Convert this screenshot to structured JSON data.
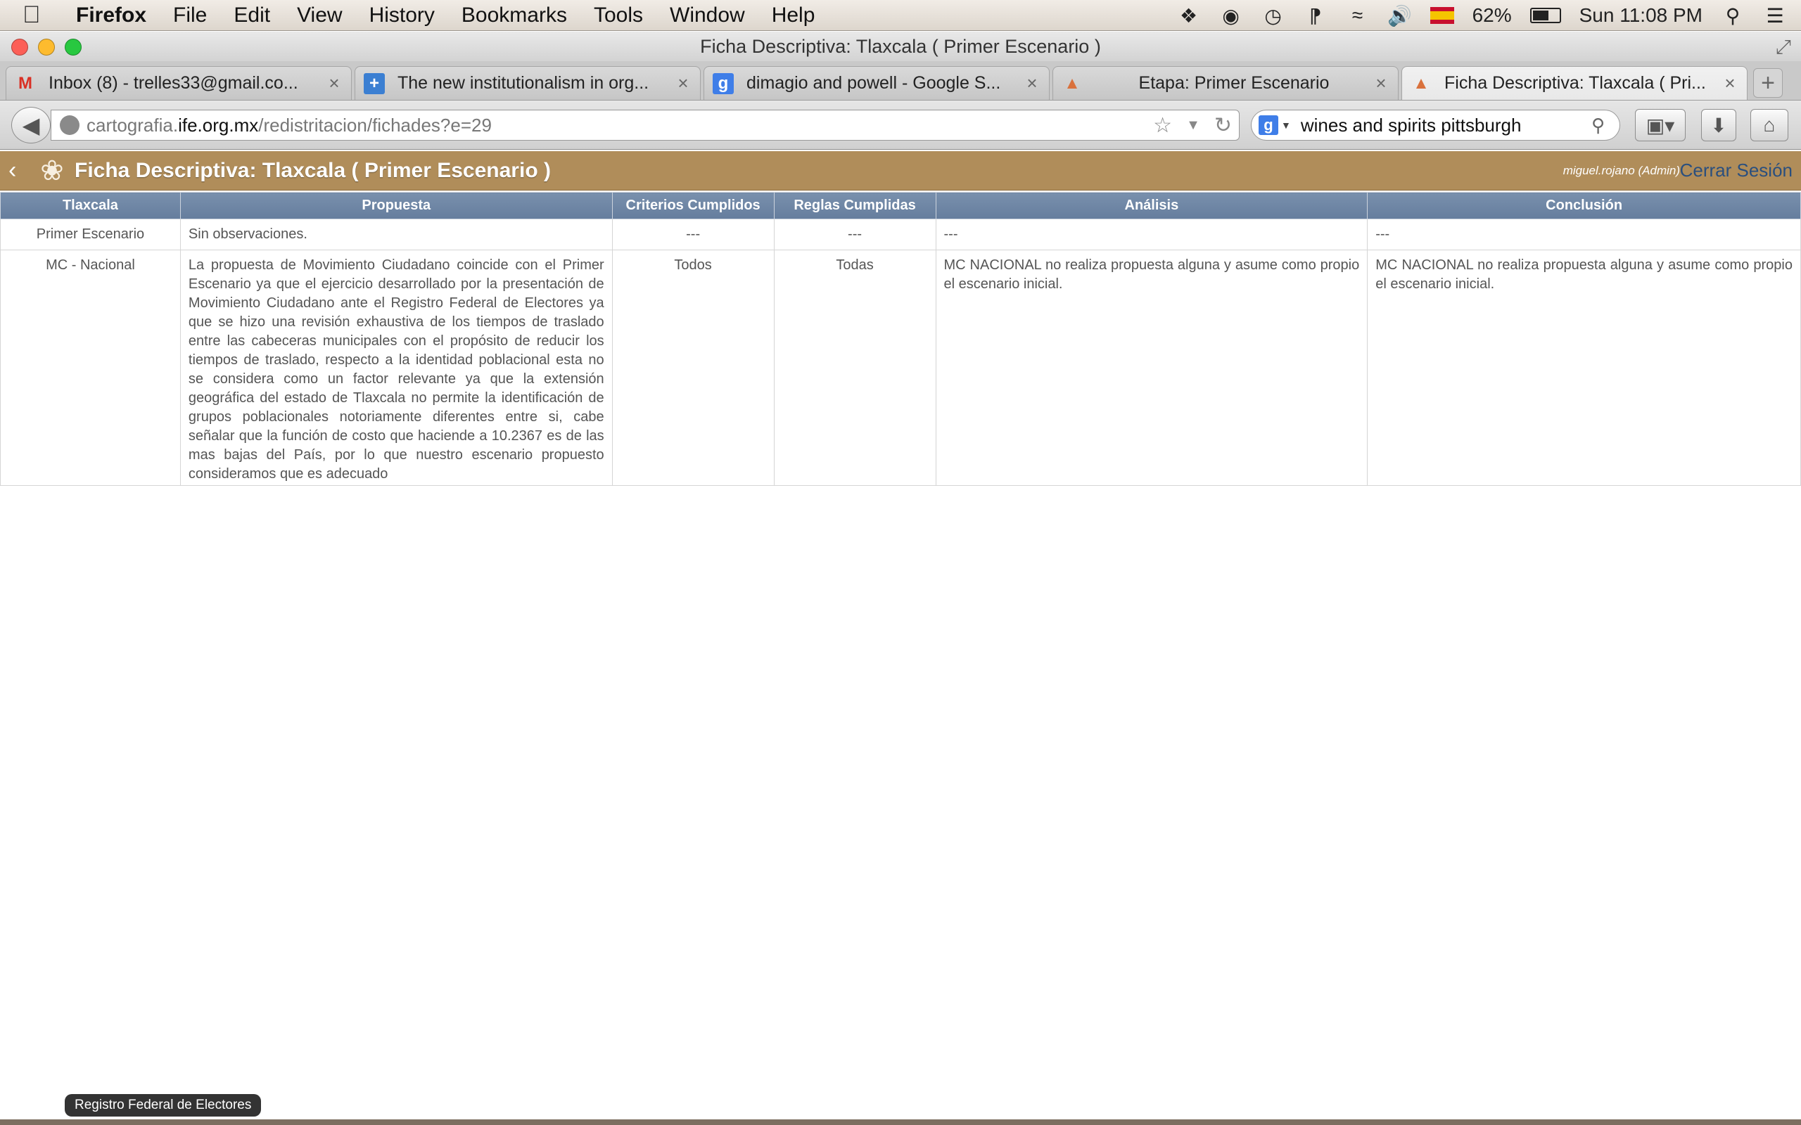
{
  "menubar": {
    "app": "Firefox",
    "items": [
      "File",
      "Edit",
      "View",
      "History",
      "Bookmarks",
      "Tools",
      "Window",
      "Help"
    ],
    "battery": "62%",
    "battery_level": 0.62,
    "clock": "Sun 11:08 PM"
  },
  "window": {
    "title": "Ficha Descriptiva: Tlaxcala ( Primer Escenario )"
  },
  "tabs": [
    {
      "label": "Inbox (8) - trelles33@gmail.co...",
      "icon": "gmail-icon"
    },
    {
      "label": "The new institutionalism in org...",
      "icon": "plus-icon"
    },
    {
      "label": "dimagio and powell - Google S...",
      "icon": "google-icon"
    },
    {
      "label": "Etapa: Primer Escenario",
      "icon": "ife-icon"
    },
    {
      "label": "Ficha Descriptiva: Tlaxcala ( Pri...",
      "icon": "ife-icon",
      "active": true
    }
  ],
  "url": {
    "prefix": "cartografia.",
    "host": "ife.org.mx",
    "path": "/redistritacion/fichades?e=29"
  },
  "search": {
    "query": "wines and spirits pittsburgh"
  },
  "app": {
    "title": "Ficha Descriptiva: Tlaxcala ( Primer Escenario )",
    "user": "miguel.rojano (Admin)",
    "logout": "Cerrar Sesión"
  },
  "table": {
    "headers": [
      "Tlaxcala",
      "Propuesta",
      "Criterios Cumplidos",
      "Reglas Cumplidas",
      "Análisis",
      "Conclusión"
    ],
    "rows": [
      [
        "Primer Escenario",
        "Sin observaciones.",
        "---",
        "---",
        "---",
        "---"
      ],
      [
        "MC - Nacional",
        "La propuesta de Movimiento Ciudadano coincide con el Primer Escenario ya que el ejercicio desarrollado por la presentación de Movimiento Ciudadano ante el Registro Federal de Electores ya que se hizo una revisión exhaustiva de los tiempos de traslado entre las cabeceras municipales con el propósito de reducir los tiempos de traslado, respecto a la identidad poblacional esta no se considera como un factor relevante ya que la extensión geográfica del estado de Tlaxcala  no permite la identificación de grupos poblacionales notoriamente diferentes entre si, cabe señalar que la función de costo que haciende a 10.2367 es de las mas bajas del País, por lo que nuestro escenario propuesto consideramos que es adecuado",
        "Todos",
        "Todas",
        "MC NACIONAL no realiza propuesta alguna y asume como propio el escenario inicial.",
        "MC NACIONAL no realiza propuesta alguna y asume como propio el escenario inicial."
      ]
    ]
  },
  "footer": {
    "badge": "Registro Federal de Electores"
  },
  "colors": {
    "header_bar": "#b08d5a",
    "table_header": "#6e85a5",
    "logout_link": "#2a4f7e"
  }
}
